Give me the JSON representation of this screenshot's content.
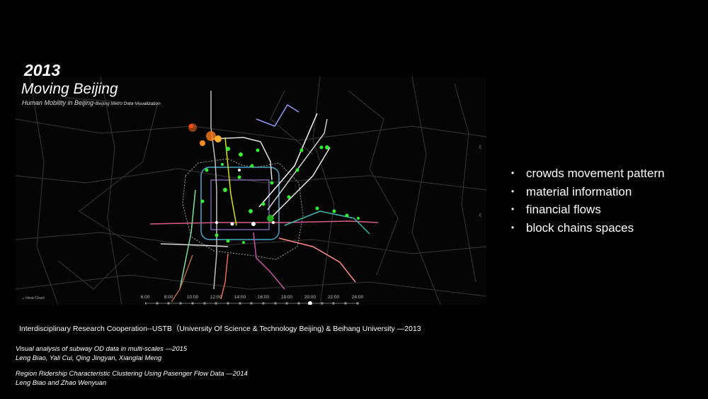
{
  "visualization": {
    "year": "2013",
    "title": "Moving Beijing",
    "subtitle_main": "Human Mobility in Beijing-",
    "subtitle_small": "Beijing Metro Data Visualization",
    "heat_chart_label": "Heat Chart",
    "time_ticks": [
      "6:00",
      "8:00",
      "10:00",
      "12:00",
      "14:00",
      "16:00",
      "18:00",
      "20:00",
      "22:00",
      "24:00"
    ]
  },
  "bullets": [
    "crowds movement pattern",
    "material information",
    "financial flows",
    "block chains spaces"
  ],
  "credit": "Interdisciplinary Research Cooperation--USTB（University Of Science & Technology Beijing) & Beihang University —2013",
  "references": [
    {
      "title": "Visual analysis of subway OD data in multi-scales —2015",
      "authors": "Leng Biao, Yali Cui, Qing Jingyan, Xianglai Meng"
    },
    {
      "title": "Region Ridership Characteristic Clustering Using Pasenger Flow Data —2014",
      "authors": "Leng Biao and Zhao Wenyuan"
    }
  ],
  "icons": {
    "next_arrow": "chevron-left-icon",
    "collapse": "chevron-down-icon",
    "play": "play-icon"
  },
  "colors": {
    "background": "#000000",
    "heat_green": "#33ee33",
    "heat_orange": "#ff7a1a"
  }
}
